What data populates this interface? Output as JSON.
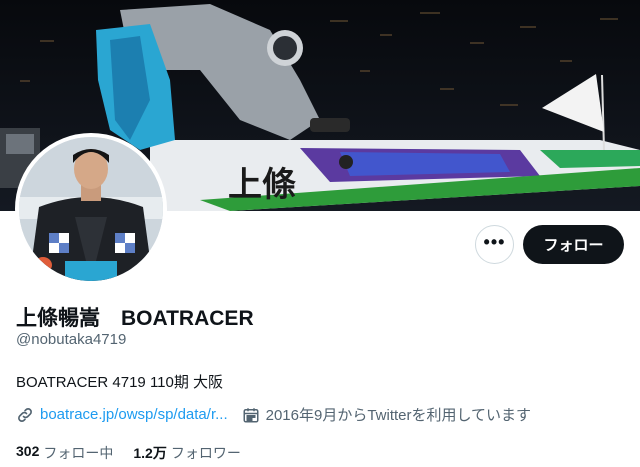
{
  "banner": {
    "boat_text": "上條",
    "icon": "racing-photo"
  },
  "avatar": {
    "icon": "racer-portrait"
  },
  "actions": {
    "more_label": "•••",
    "follow_label": "フォロー"
  },
  "profile": {
    "display_name": "上條暢嵩　BOATRACER",
    "handle": "@nobutaka4719",
    "bio": "BOATRACER 4719 110期 大阪",
    "link_text": "boatrace.jp/owsp/sp/data/r...",
    "joined_text": "2016年9月からTwitterを利用しています"
  },
  "stats": {
    "following_count": "302",
    "following_label": "フォロー中",
    "followers_count": "1.2万",
    "followers_label": "フォロワー"
  },
  "colors": {
    "link": "#1d9bf0",
    "muted": "#536471",
    "text": "#0f1419",
    "follow_bg": "#0f1419"
  }
}
